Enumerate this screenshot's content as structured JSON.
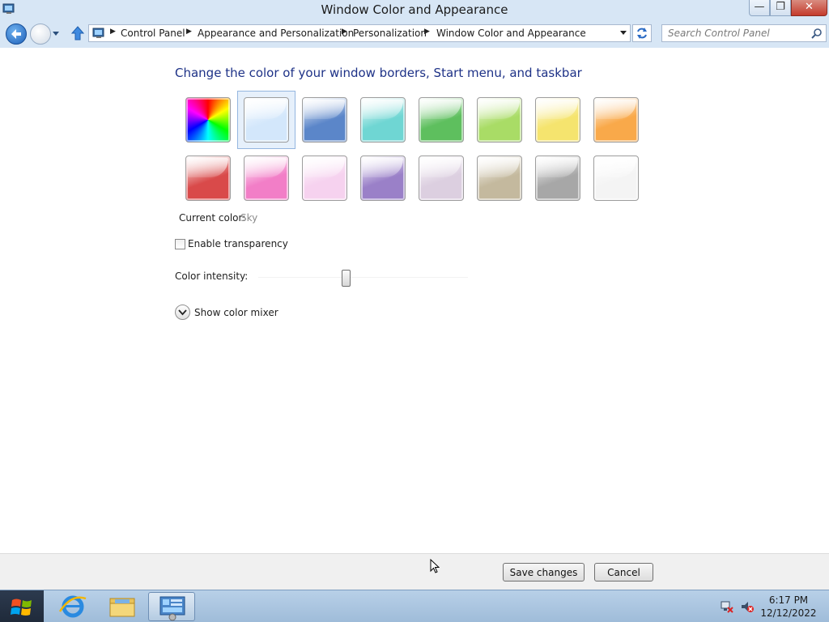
{
  "window": {
    "title": "Window Color and Appearance",
    "minimize_glyph": "—",
    "maximize_glyph": "❐",
    "close_glyph": "✕"
  },
  "nav": {
    "breadcrumbs": [
      "Control Panel",
      "Appearance and Personalization",
      "Personalization",
      "Window Color and Appearance"
    ],
    "separator": "▶",
    "search_placeholder": "Search Control Panel"
  },
  "content": {
    "heading": "Change the color of your window borders, Start menu, and taskbar",
    "colors_row1": [
      "rainbow",
      "#d3e7fb",
      "#5b86c9",
      "#6fd6d3",
      "#5ebf5e",
      "#a9dc66",
      "#f5e46e",
      "#f9a94a"
    ],
    "colors_row2": [
      "#d94a4a",
      "#f27ec7",
      "#f6d2ef",
      "#9a80c8",
      "#dccfe0",
      "#c4b99e",
      "#a7a7a7",
      "#f4f4f4"
    ],
    "selected_index": 1,
    "current_color_label": "Current color:",
    "current_color_value": "Sky",
    "transparency_label": "Enable transparency",
    "transparency_checked": false,
    "intensity_label": "Color intensity:",
    "intensity_value": 0.42,
    "mixer_label": "Show color mixer"
  },
  "footer": {
    "save_label": "Save changes",
    "cancel_label": "Cancel"
  },
  "taskbar": {
    "time": "6:17 PM",
    "date": "12/12/2022"
  }
}
